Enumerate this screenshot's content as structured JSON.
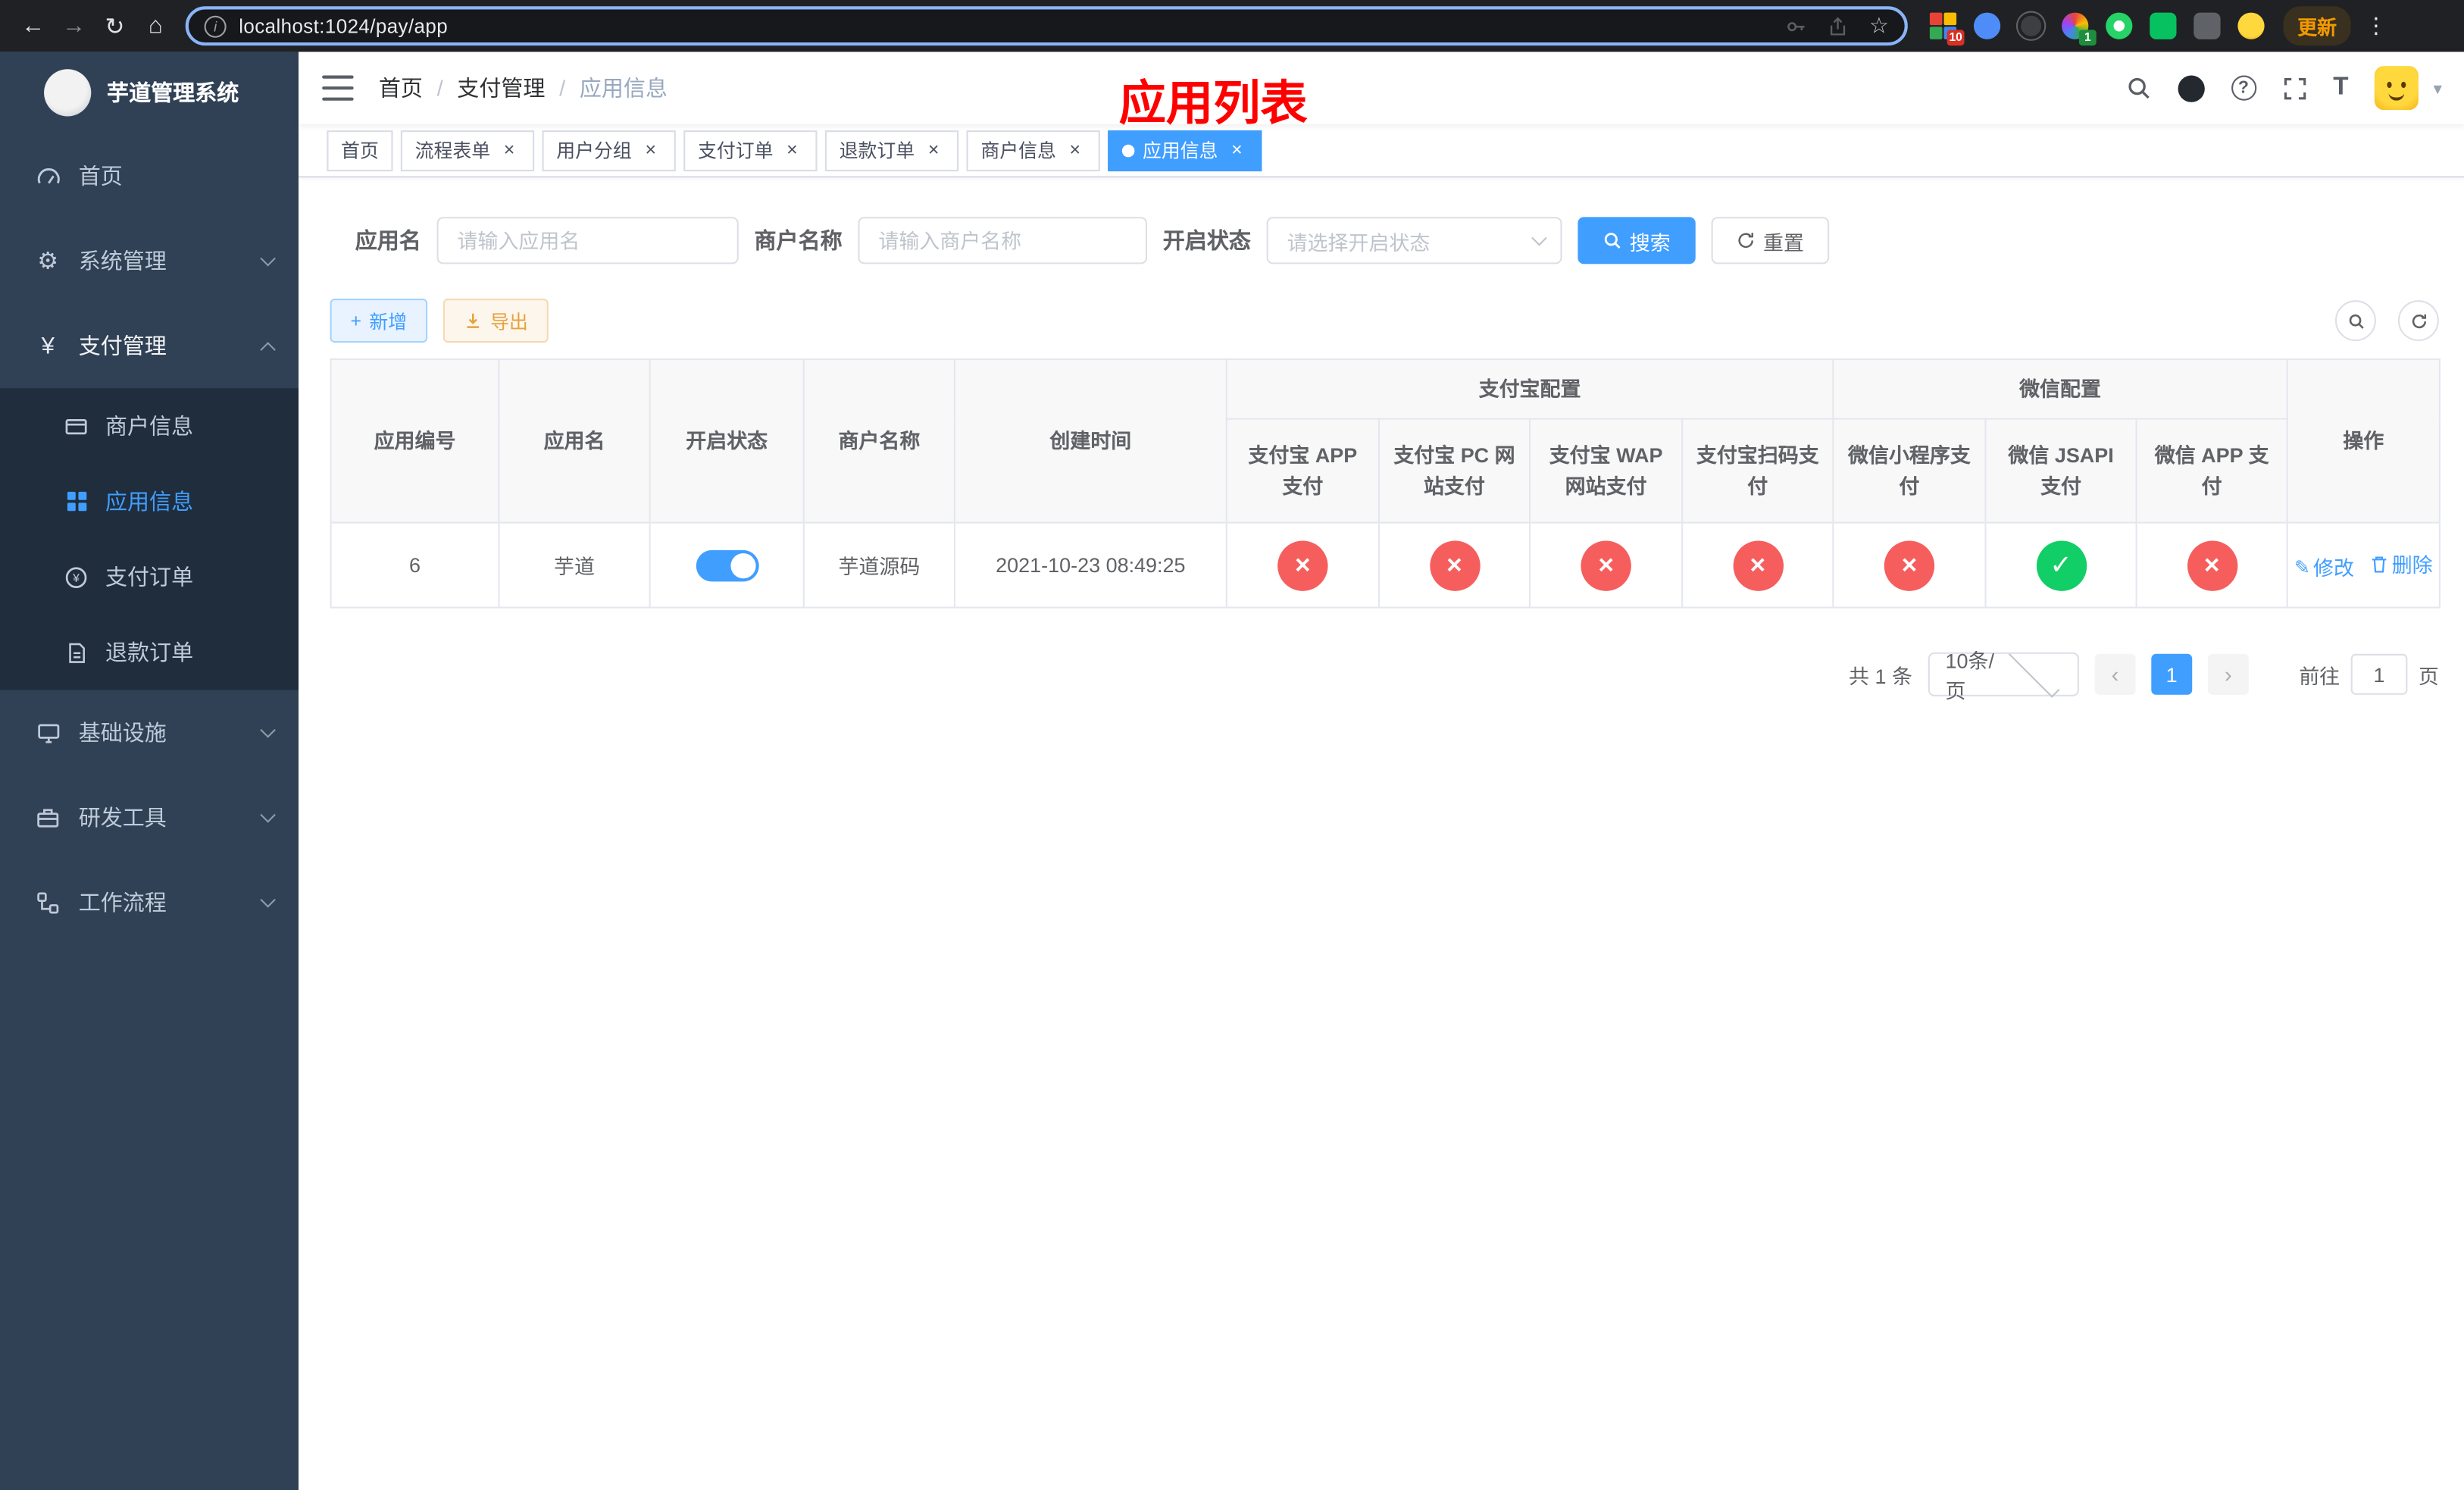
{
  "browser": {
    "url": "localhost:1024/pay/app",
    "update_label": "更新",
    "ext_badge_red": "10",
    "ext_badge_green": "1"
  },
  "icons": {
    "back": "←",
    "forward": "→",
    "reload": "↻",
    "home": "⌂",
    "menu": "⋮",
    "star": "☆",
    "caret_down": "▾",
    "plus": "+",
    "gear": "⚙",
    "yen": "¥",
    "close": "×",
    "check": "✓",
    "cross": "×",
    "edit": "✎",
    "info": "i",
    "question": "?",
    "font_size": "T",
    "prev": "‹",
    "next": "›"
  },
  "sidebar": {
    "title": "芋道管理系统",
    "items": [
      {
        "label": "首页"
      },
      {
        "label": "系统管理"
      },
      {
        "label": "支付管理"
      },
      {
        "label": "基础设施"
      },
      {
        "label": "研发工具"
      },
      {
        "label": "工作流程"
      }
    ],
    "sub_items": [
      {
        "label": "商户信息"
      },
      {
        "label": "应用信息"
      },
      {
        "label": "支付订单"
      },
      {
        "label": "退款订单"
      }
    ]
  },
  "header": {
    "breadcrumb": [
      "首页",
      "支付管理",
      "应用信息"
    ],
    "annotation": "应用列表"
  },
  "tabs": [
    {
      "label": "首页"
    },
    {
      "label": "流程表单"
    },
    {
      "label": "用户分组"
    },
    {
      "label": "支付订单"
    },
    {
      "label": "退款订单"
    },
    {
      "label": "商户信息"
    },
    {
      "label": "应用信息"
    }
  ],
  "filters": {
    "app_name_label": "应用名",
    "app_name_placeholder": "请输入应用名",
    "merchant_label": "商户名称",
    "merchant_placeholder": "请输入商户名称",
    "status_label": "开启状态",
    "status_placeholder": "请选择开启状态",
    "search_label": "搜索",
    "reset_label": "重置"
  },
  "toolbar": {
    "add_label": "新增",
    "export_label": "导出"
  },
  "table": {
    "groups": {
      "alipay": "支付宝配置",
      "wechat": "微信配置"
    },
    "columns": {
      "id": "应用编号",
      "name": "应用名",
      "status": "开启状态",
      "merchant": "商户名称",
      "created": "创建时间",
      "alipay_app": "支付宝 APP 支付",
      "alipay_pc": "支付宝 PC 网站支付",
      "alipay_wap": "支付宝 WAP 网站支付",
      "alipay_qr": "支付宝扫码支付",
      "wx_mini": "微信小程序支付",
      "wx_jsapi": "微信 JSAPI 支付",
      "wx_app": "微信 APP 支付",
      "actions": "操作"
    },
    "row": {
      "id": "6",
      "name": "芋道",
      "enabled": true,
      "merchant": "芋道源码",
      "created": "2021-10-23 08:49:25",
      "alipay_app": false,
      "alipay_pc": false,
      "alipay_wap": false,
      "alipay_qr": false,
      "wx_mini": false,
      "wx_jsapi": true,
      "wx_app": false,
      "edit_label": "修改",
      "delete_label": "删除"
    }
  },
  "pagination": {
    "total": "共 1 条",
    "page_size": "10条/页",
    "page": "1",
    "goto_label": "前往",
    "goto_value": "1",
    "page_unit": "页"
  }
}
